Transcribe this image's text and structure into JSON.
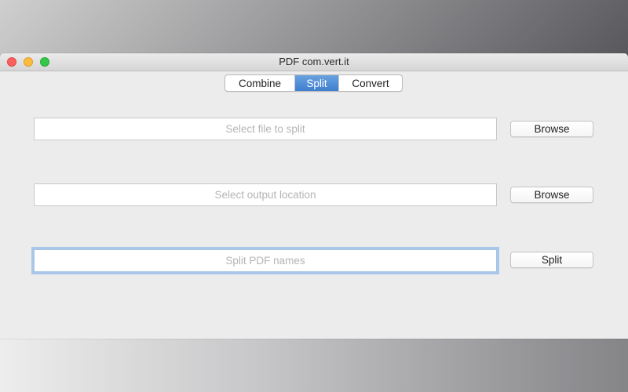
{
  "window": {
    "title": "PDF com.vert.it"
  },
  "tabs": [
    {
      "label": "Combine",
      "selected": false
    },
    {
      "label": "Split",
      "selected": true
    },
    {
      "label": "Convert",
      "selected": false
    }
  ],
  "form": {
    "source": {
      "placeholder": "Select file to split",
      "value": "",
      "button": "Browse"
    },
    "output": {
      "placeholder": "Select output location",
      "value": "",
      "button": "Browse"
    },
    "names": {
      "placeholder": "Split PDF names",
      "value": "",
      "button": "Split",
      "focused": true
    }
  },
  "colors": {
    "selected_tab": "#4a8ad6",
    "focus_ring": "#a9c7ea",
    "close": "#fc605c",
    "minimize": "#fdbc40",
    "zoom": "#34c84a"
  }
}
